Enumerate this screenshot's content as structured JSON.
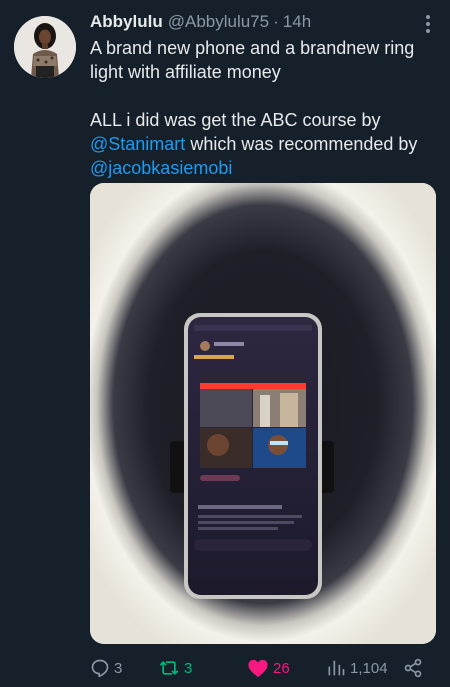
{
  "tweet": {
    "display_name": "Abbylulu",
    "handle": "@Abbylulu75",
    "separator": "·",
    "time": "14h",
    "text_line1": "A brand new phone and a brandnew ring light with affiliate money",
    "text_line2_prefix": "ALL i did was get the ABC course by",
    "mention1": "@Stanimart",
    "text_line2_mid": " which was recommended by",
    "mention2": "@jacobkasiemobi"
  },
  "actions": {
    "replies": "3",
    "retweets": "3",
    "likes": "26",
    "views": "1,104"
  },
  "colors": {
    "background": "#15202b",
    "text": "#e7e9ea",
    "muted": "#8b98a5",
    "link": "#1d9bf0",
    "retweet_active": "#00ba7c",
    "like_active": "#f91880"
  },
  "icons": {
    "more": "more-dots-icon",
    "reply": "reply-icon",
    "retweet": "retweet-icon",
    "like": "heart-icon",
    "views": "views-chart-icon",
    "share": "share-icon"
  }
}
